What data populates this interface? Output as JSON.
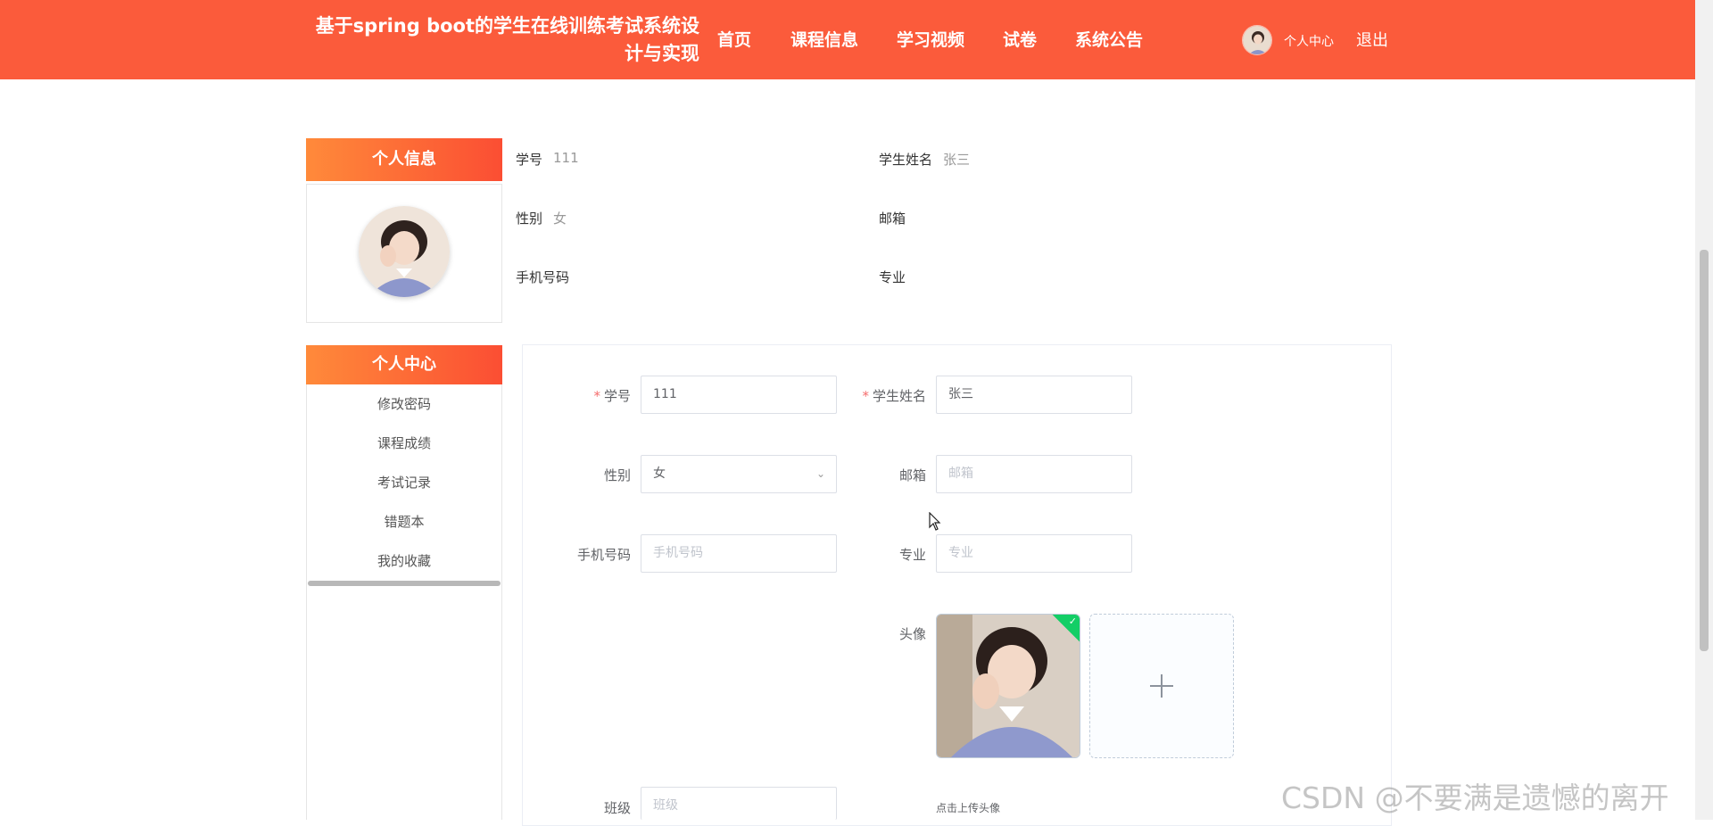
{
  "header": {
    "title_line1": "基于spring boot的学生在线训练考试系统设",
    "title_line2": "计与实现",
    "nav": [
      "首页",
      "课程信息",
      "学习视频",
      "试卷",
      "系统公告"
    ],
    "user_center": "个人中心",
    "logout": "退出",
    "bg_color": "#fb5b3b"
  },
  "profile": {
    "title": "个人信息",
    "fields": [
      {
        "label": "学号",
        "value": "111"
      },
      {
        "label": "学生姓名",
        "value": "张三"
      },
      {
        "label": "性别",
        "value": "女"
      },
      {
        "label": "邮箱",
        "value": ""
      },
      {
        "label": "手机号码",
        "value": ""
      },
      {
        "label": "专业",
        "value": ""
      }
    ]
  },
  "sidebar": {
    "title": "个人中心",
    "items": [
      "修改密码",
      "课程成绩",
      "考试记录",
      "错题本",
      "我的收藏"
    ]
  },
  "form": {
    "student_id": {
      "label": "学号",
      "value": "111",
      "required": true
    },
    "student_name": {
      "label": "学生姓名",
      "value": "张三",
      "required": true
    },
    "gender": {
      "label": "性别",
      "value": "女"
    },
    "email": {
      "label": "邮箱",
      "placeholder": "邮箱"
    },
    "phone": {
      "label": "手机号码",
      "placeholder": "手机号码"
    },
    "major": {
      "label": "专业",
      "placeholder": "专业"
    },
    "avatar": {
      "label": "头像",
      "hint": "点击上传头像"
    },
    "class_field": {
      "label": "班级",
      "placeholder": "班级"
    }
  },
  "watermark": "CSDN @不要满是遗憾的离开",
  "icons": {
    "upload": "plus-icon",
    "status": "check-icon",
    "select": "chevron-down-icon"
  }
}
